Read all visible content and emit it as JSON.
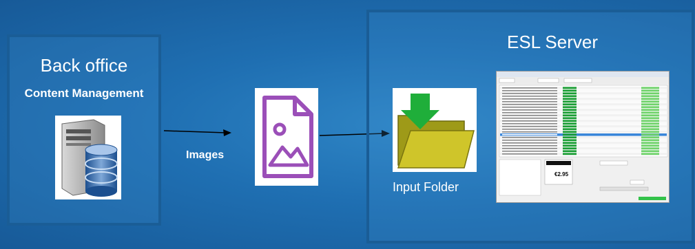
{
  "backoffice": {
    "title": "Back office",
    "subtitle": "Content Management"
  },
  "esl": {
    "title": "ESL Server",
    "input_label": "Input Folder"
  },
  "flow": {
    "images_label": "Images"
  },
  "screen": {
    "price": "€2.95"
  }
}
